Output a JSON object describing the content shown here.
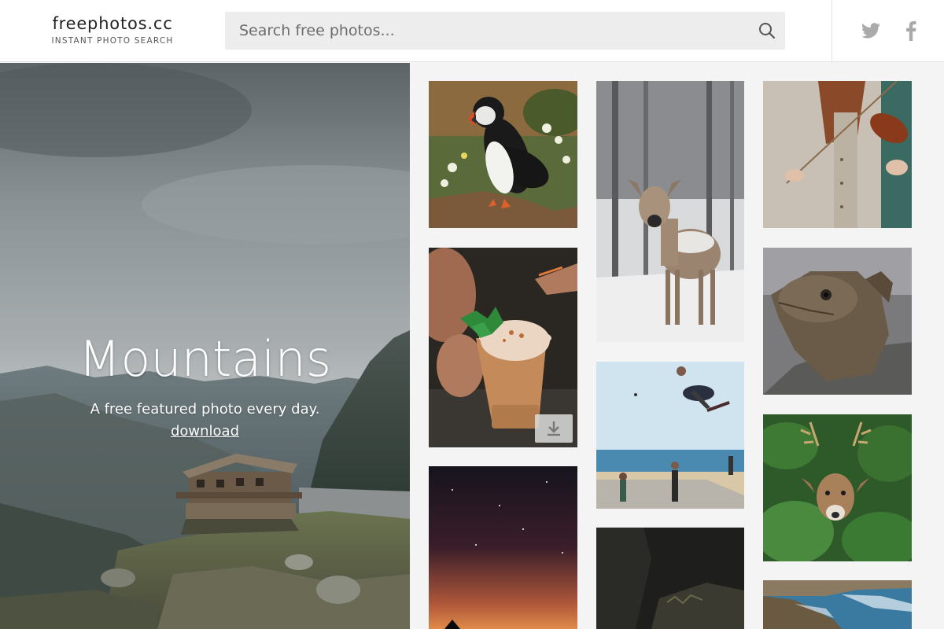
{
  "header": {
    "logo_title": "freephotos.cc",
    "logo_subtitle": "INSTANT PHOTO SEARCH",
    "search_placeholder": "Search free photos...",
    "social": [
      "twitter-icon",
      "facebook-icon"
    ]
  },
  "hero": {
    "title": "Mountains",
    "subtitle": "A free featured photo every day.",
    "link": "download"
  },
  "grid": {
    "photos": [
      {
        "subject": "puffin"
      },
      {
        "subject": "deer in snow"
      },
      {
        "subject": "violinist"
      },
      {
        "subject": "copper mug cocktail",
        "download_icon": "download-icon"
      },
      {
        "subject": "skateboarder at beach"
      },
      {
        "subject": "iguana"
      },
      {
        "subject": "night sky"
      },
      {
        "subject": "dark cliff"
      },
      {
        "subject": "deer in ferns"
      },
      {
        "subject": "coastline"
      }
    ]
  },
  "colors": {
    "header_bg": "#ffffff",
    "search_bg": "#ededed",
    "page_bg": "#f4f4f4",
    "icon_gray": "#aaaaaa"
  }
}
